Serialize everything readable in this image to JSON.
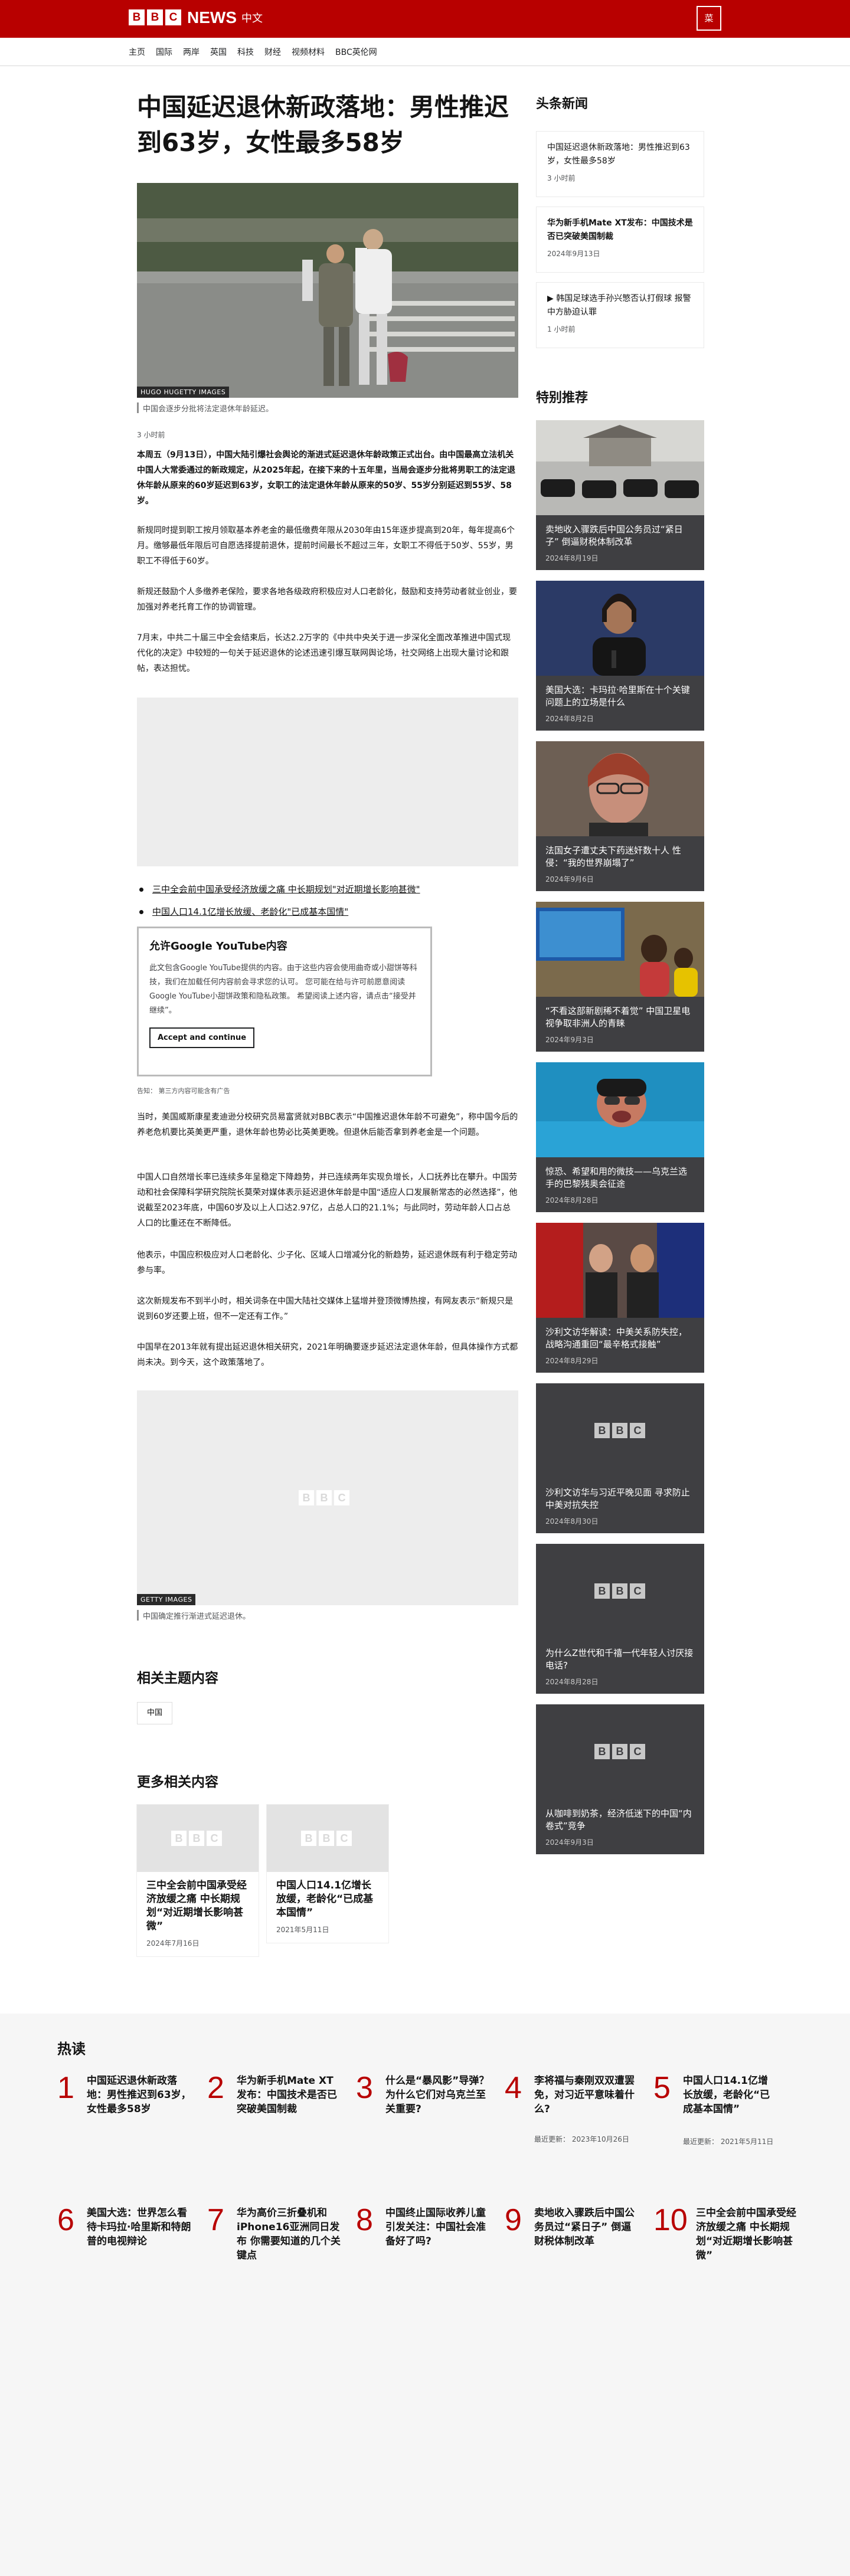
{
  "header": {
    "logo_letters": [
      "B",
      "B",
      "C"
    ],
    "news": "NEWS",
    "edition": "中文",
    "menu_label": "菜"
  },
  "nav": [
    "主页",
    "国际",
    "两岸",
    "英国",
    "科技",
    "财经",
    "视频材料",
    "BBC英伦网"
  ],
  "article": {
    "headline": "中国延迟退休新政落地：男性推迟到63岁，女性最多58岁",
    "hero_credit": "HUGO HUGETTY IMAGES",
    "hero_caption": "中国会逐步分批将法定退休年龄延迟。",
    "time": "3 小时前",
    "p1": "本周五（9月13日），中国大陆引爆社会舆论的渐进式延迟退休年龄政策正式出台。由中国最高立法机关中国人大常委通过的新政规定，从2025年起，在接下来的十五年里，当局会逐步分批将男职工的法定退休年龄从原来的60岁延迟到63岁，女职工的法定退休年龄从原来的50岁、55岁分别延迟到55岁、58岁。",
    "p2": "新规同时提到职工按月领取基本养老金的最低缴费年限从2030年由15年逐步提高到20年，每年提高6个月。缴够最低年限后可自愿选择提前退休，提前时间最长不超过三年，女职工不得低于50岁、55岁，男职工不得低于60岁。",
    "p3": "新规还鼓励个人多缴养老保险，要求各地各级政府积极应对人口老龄化，鼓励和支持劳动者就业创业，要加强对养老托育工作的协调管理。",
    "p4": "7月末，中共二十届三中全会结束后，长达2.2万字的《中共中央关于进一步深化全面改革推进中国式现代化的决定》中较短的一句关于延迟退休的论述迅速引爆互联网舆论场，社交网络上出现大量讨论和跟帖，表达担忧。",
    "bullets": [
      "三中全会前中国承受经济放缓之痛 中长期规划\"对近期增长影响甚微\"",
      "中国人口14.1亿增长放缓、老龄化\"已成基本国情\""
    ],
    "yt_title": "允许Google YouTube内容",
    "yt_text": "此文包含Google YouTube提供的内容。由于这些内容会使用曲奇或小甜饼等科技，我们在加载任何内容前会寻求您的认可。 您可能在给与许可前愿意阅读Google YouTube小甜饼政策和隐私政策。 希望阅读上述内容，请点击“接受并继续”。",
    "yt_button": "Accept and continue",
    "yt_note": "告知： 第三方内容可能含有广告",
    "p5": "当时，美国威斯康星麦迪逊分校研究员易富贤就对BBC表示“中国推迟退休年龄不可避免”，称中国今后的养老危机要比英美更严重，退休年龄也势必比英美更晚。但退休后能否拿到养老金是一个问题。",
    "p6": "中国人口自然增长率已连续多年呈稳定下降趋势，并已连续两年实现负增长，人口抚养比在攀升。中国劳动和社会保障科学研究院院长莫荣对媒体表示延迟退休年龄是中国“适应人口发展新常态的必然选择”，他说截至2023年底，中国60岁及以上人口达2.97亿，占总人口的21.1%；与此同时，劳动年龄人口占总人口的比重还在不断降低。",
    "p7": "他表示，中国应积极应对人口老龄化、少子化、区域人口增减分化的新趋势，延迟退休既有利于稳定劳动参与率。",
    "p8": "这次新规发布不到半小时，相关词条在中国大陆社交媒体上猛增并登顶微博热搜，有网友表示“新规只是说到60岁还要上班，但不一定还有工作。”",
    "p9": "中国早在2013年就有提出延迟退休相关研究，2021年明确要逐步延迟法定退休年龄，但具体操作方式都尚未决。到今天，这个政策落地了。",
    "img2_credit": "GETTY IMAGES",
    "img2_caption": "中国确定推行渐进式延迟退休。",
    "related_title": "相关主题内容",
    "related_tag": "中国",
    "more_title": "更多相关内容",
    "more": [
      {
        "title": "三中全会前中国承受经济放缓之痛 中长期规划“对近期增长影响甚微”",
        "date": "2024年7月16日"
      },
      {
        "title": "中国人口14.1亿增长放缓，老龄化“已成基本国情”",
        "date": "2021年5月11日"
      }
    ]
  },
  "aside": {
    "top_title": "头条新闻",
    "top": [
      {
        "title": "中国延迟退休新政落地：男性推迟到63岁，女性最多58岁",
        "date": "3 小时前"
      },
      {
        "title": "华为新手机Mate XT发布：中国技术是否已突破美国制裁",
        "date": "2024年9月13日",
        "bold": true
      },
      {
        "title": "▶ 韩国足球选手孙兴慜否认打假球 报警中方胁迫认罪",
        "date": "1 小时前"
      }
    ],
    "feat_title": "特别推荐",
    "feat": [
      {
        "title": "卖地收入骤跌后中国公务员过“紧日子” 倒逼财税体制改革",
        "date": "2024年8月19日"
      },
      {
        "title": "美国大选：卡玛拉·哈里斯在十个关键问题上的立场是什么",
        "date": "2024年8月2日"
      },
      {
        "title": "法国女子遭丈夫下药迷奸数十人 性侵：“我的世界崩塌了”",
        "date": "2024年9月6日"
      },
      {
        "title": "“不看这部新剧稀不着觉” 中国卫星电视争取非洲人的青睐",
        "date": "2024年9月3日"
      },
      {
        "title": "惊恐、希望和用的微技——乌克兰选手的巴黎残奥会征途",
        "date": "2024年8月28日"
      },
      {
        "title": "沙利文访华解读：中美关系防失控，战略沟通重回“最辛格式接触”",
        "date": "2024年8月29日"
      },
      {
        "title": "沙利文访华与习近平晚见面 寻求防止中美对抗失控",
        "date": "2024年8月30日"
      },
      {
        "title": "为什么Z世代和千禧一代年轻人讨厌接电话?",
        "date": "2024年8月28日"
      },
      {
        "title": "从咖啡到奶茶，经济低迷下的中国“内卷式”竞争",
        "date": "2024年9月3日"
      }
    ]
  },
  "popular": {
    "title": "热读",
    "update_label": "最近更新：",
    "items": [
      {
        "n": "1",
        "title": "中国延迟退休新政落地：男性推迟到63岁，女性最多58岁",
        "updated": ""
      },
      {
        "n": "2",
        "title": "华为新手机Mate XT发布：中国技术是否已突破美国制裁",
        "updated": ""
      },
      {
        "n": "3",
        "title": "什么是“暴风影”导弹？为什么它们对乌克兰至关重要?",
        "updated": ""
      },
      {
        "n": "4",
        "title": "李将福与秦刚双双遭罢免，对习近平意味着什么?",
        "updated": "2023年10月26日"
      },
      {
        "n": "5",
        "title": "中国人口14.1亿增长放缓，老龄化“已成基本国情”",
        "updated": "2021年5月11日"
      },
      {
        "n": "6",
        "title": "美国大选：世界怎么看待卡玛拉·哈里斯和特朗普的电视辩论",
        "updated": ""
      },
      {
        "n": "7",
        "title": "华为高价三折叠机和iPhone16亚洲同日发布 你需要知道的几个关键点",
        "updated": ""
      },
      {
        "n": "8",
        "title": "中国终止国际收养儿童引发关注：中国社会准备好了吗?",
        "updated": ""
      },
      {
        "n": "9",
        "title": "卖地收入骤跌后中国公务员过“紧日子” 倒逼财税体制改革",
        "updated": ""
      },
      {
        "n": "10",
        "title": "三中全会前中国承受经济放缓之痛 中长期规划“对近期增长影响甚微”",
        "updated": ""
      }
    ]
  }
}
